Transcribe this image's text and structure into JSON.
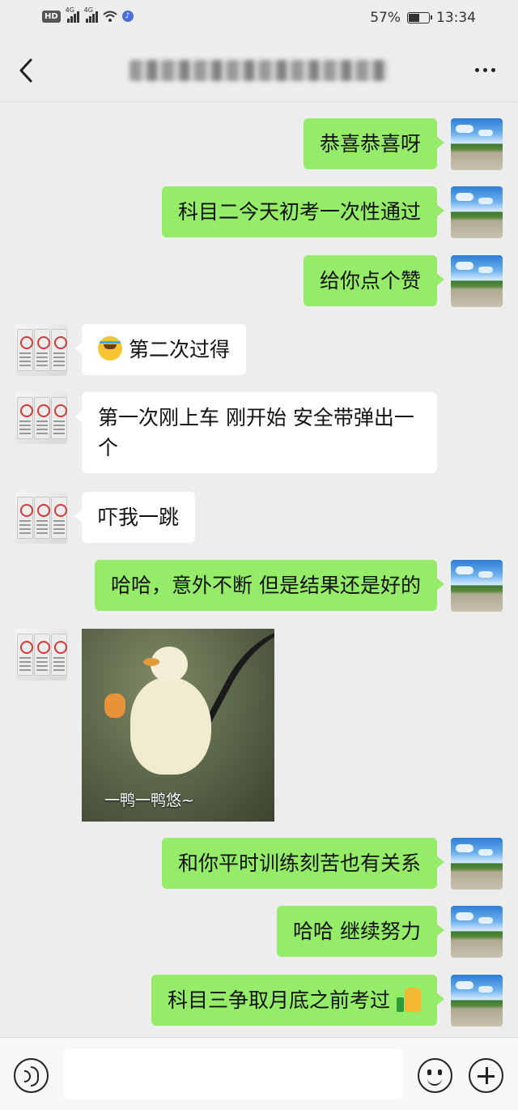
{
  "status_bar": {
    "hd_badge": "HD",
    "sim1_network": "4G",
    "sim2_network": "4G",
    "battery_percent_text": "57%",
    "battery_level": 0.57,
    "time": "13:34"
  },
  "header": {
    "title": "",
    "title_redacted": true,
    "back_icon": "chevron-left-icon",
    "more_icon": "more-dots-icon"
  },
  "messages": [
    {
      "sender": "me",
      "type": "text",
      "text": "恭喜恭喜呀"
    },
    {
      "sender": "me",
      "type": "text",
      "text": "科目二今天初考一次性通过"
    },
    {
      "sender": "me",
      "type": "text",
      "text": "给你点个赞"
    },
    {
      "sender": "them",
      "type": "text",
      "emoji": "crying-laughing-emoji",
      "text": "第二次过得"
    },
    {
      "sender": "them",
      "type": "text",
      "text": "第一次刚上车 刚开始 安全带弹出一个"
    },
    {
      "sender": "them",
      "type": "text",
      "text": "吓我一跳"
    },
    {
      "sender": "me",
      "type": "text",
      "text": "哈哈，意外不断 但是结果还是好的"
    },
    {
      "sender": "them",
      "type": "sticker",
      "caption": "一鸭一鸭悠~"
    },
    {
      "sender": "me",
      "type": "text",
      "text": "和你平时训练刻苦也有关系"
    },
    {
      "sender": "me",
      "type": "text",
      "text": "哈哈 继续努力"
    },
    {
      "sender": "me",
      "type": "text",
      "text": "科目三争取月底之前考过",
      "emoji": "thumbs-up-emoji"
    }
  ],
  "input_bar": {
    "voice_icon": "voice-icon",
    "input_value": "",
    "emoji_icon": "smiley-icon",
    "plus_icon": "plus-circle-icon"
  },
  "colors": {
    "background": "#ededed",
    "my_bubble": "#95ec69",
    "their_bubble": "#ffffff"
  }
}
